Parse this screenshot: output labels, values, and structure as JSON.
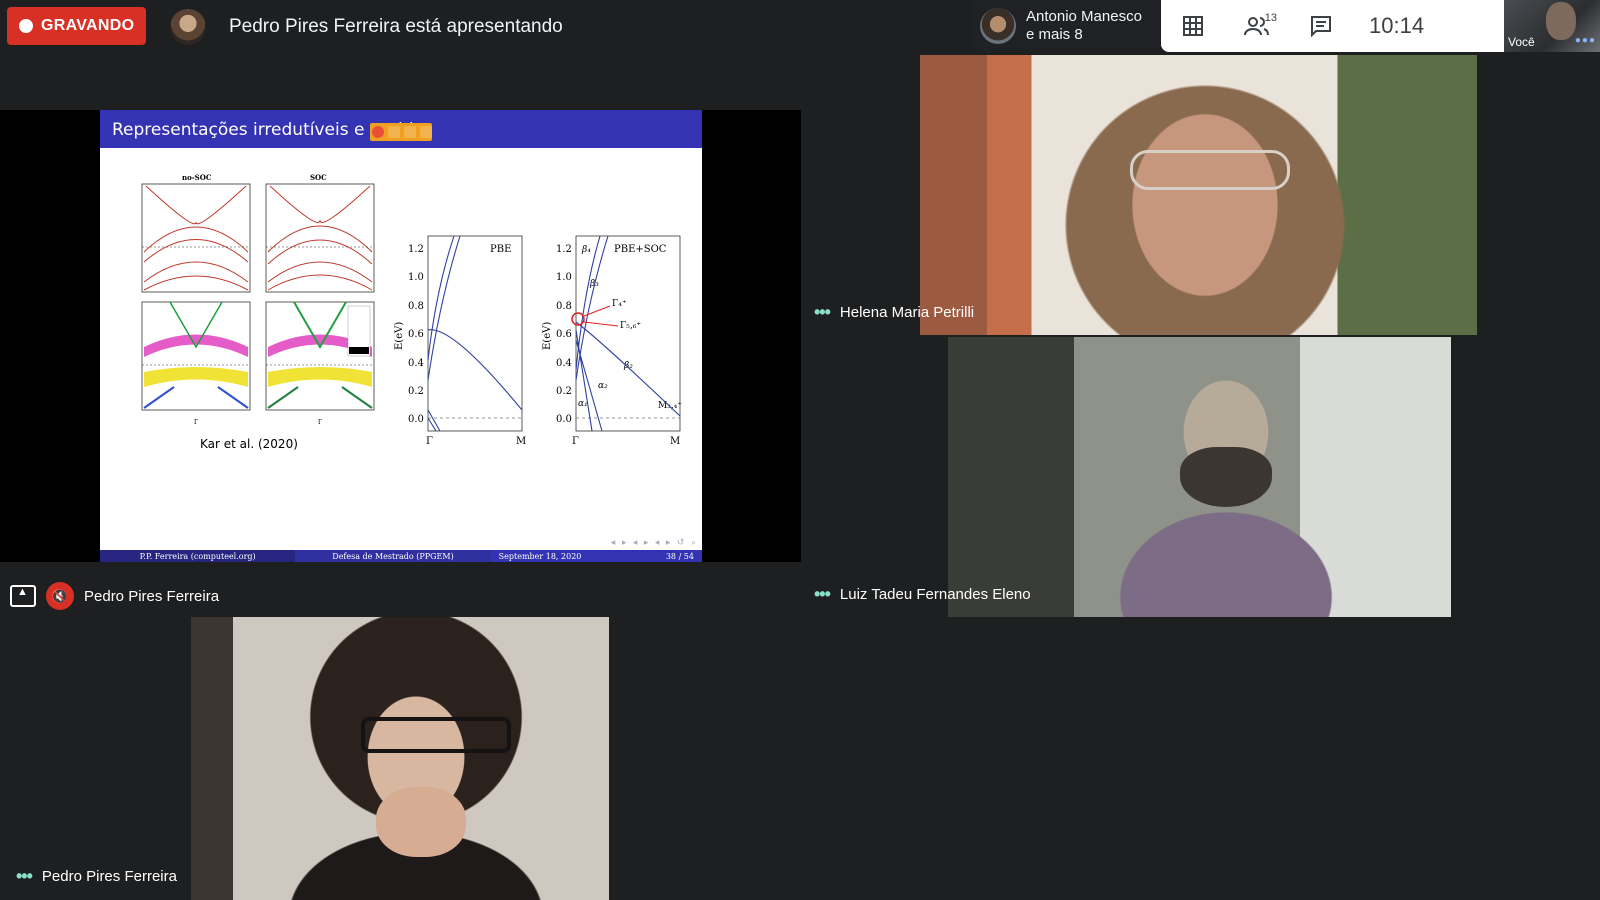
{
  "recording": {
    "label": "GRAVANDO"
  },
  "presenter_banner": {
    "text": "Pedro Pires Ferreira está apresentando"
  },
  "participants_chip": {
    "line1": "Antonio Manesco",
    "line2": "e mais 8"
  },
  "toolbar": {
    "participant_count": "13",
    "clock": "10:14"
  },
  "self_view": {
    "label": "Você"
  },
  "slide": {
    "title": "Representações irredutíveis e parid",
    "citation": "Kar et al. (2020)",
    "footer": {
      "author": "P.P. Ferreira (computeel.org)",
      "event": "Defesa de Mestrado (PPGEM)",
      "date": "September 18, 2020",
      "page": "38 / 54"
    },
    "panels": {
      "nosoc": "no-SOC",
      "soc": "SOC",
      "pbe": "PBE",
      "pbesoc": "PBE+SOC",
      "ylabel": "E(eV)",
      "gamma": "Γ",
      "m": "M"
    },
    "yticks": [
      "1.2",
      "1.0",
      "0.8",
      "0.6",
      "0.4",
      "0.2",
      "0.0"
    ]
  },
  "presentation_tile": {
    "name": "Pedro Pires Ferreira"
  },
  "tiles": [
    {
      "name": "Helena Maria Petrilli"
    },
    {
      "name": "Luiz Tadeu Fernandes Eleno"
    },
    {
      "name": "Pedro Pires Ferreira"
    }
  ],
  "colors": {
    "recording": "#d93025",
    "slide_header": "#3333b3",
    "bands": "#c0392b",
    "pbe_lines": "#3040a0"
  }
}
